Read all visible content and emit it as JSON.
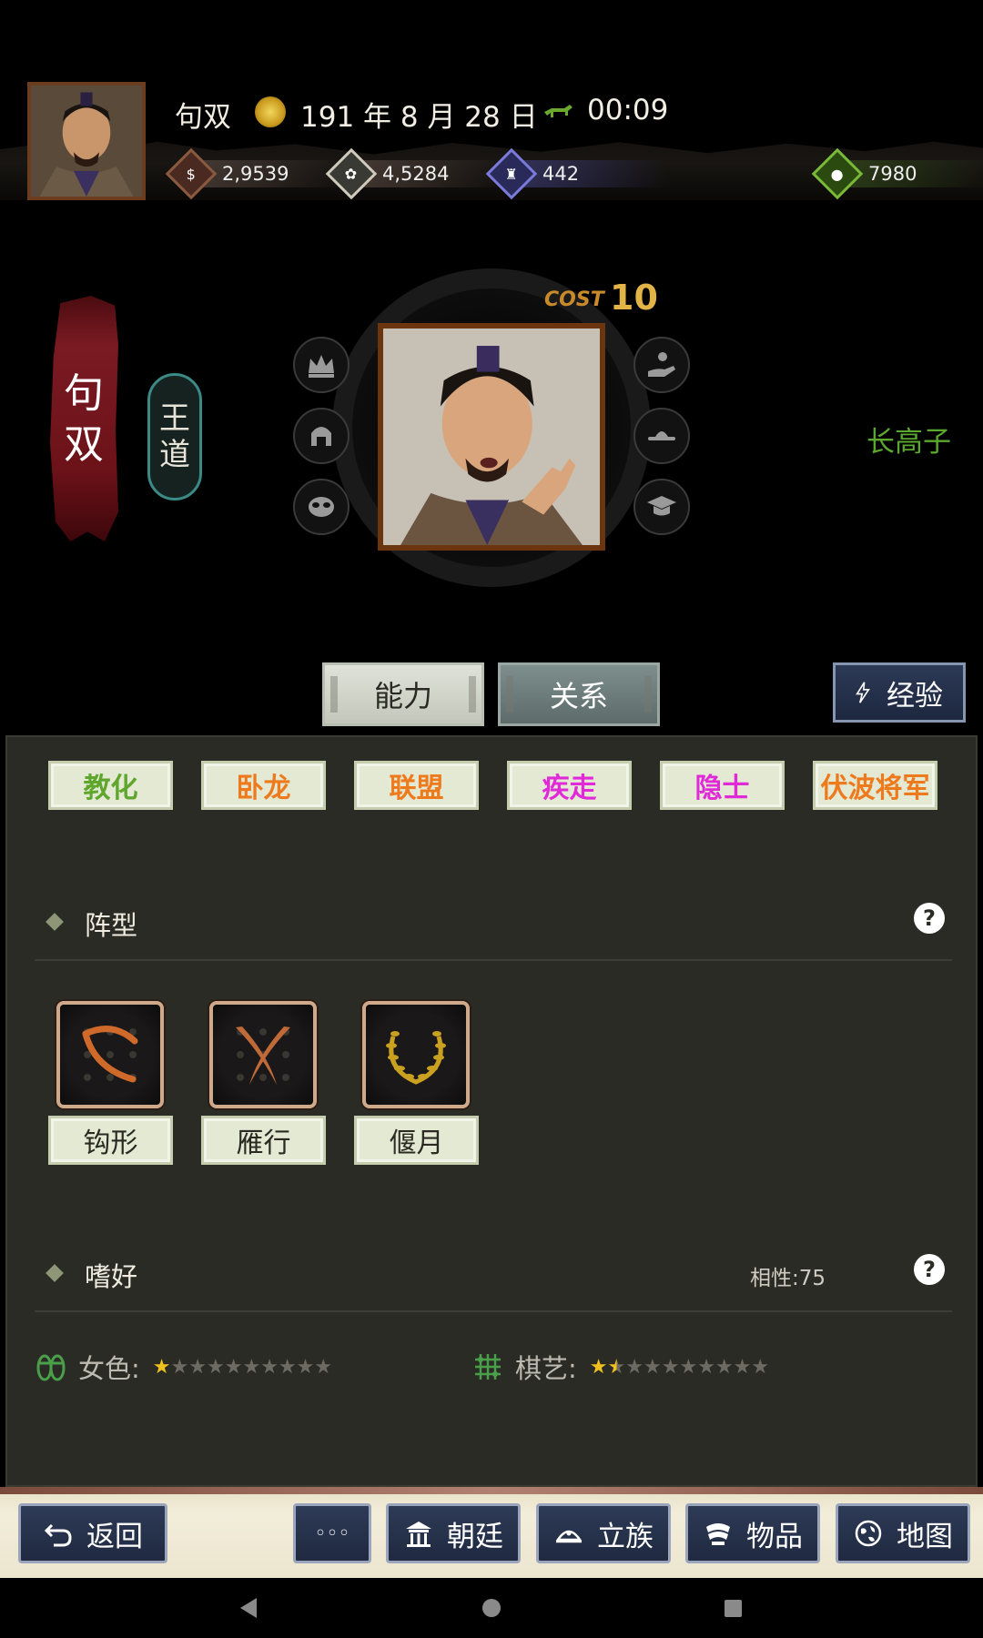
{
  "header": {
    "lord_name": "句双",
    "date": "191 年 8 月 28 日",
    "time": "00:09",
    "season_icon": "season-autumn-icon",
    "horse_icon": "horse-icon",
    "resources": {
      "gold": "2,9539",
      "grain": "4,5284",
      "troops": "442",
      "bag": "7980"
    }
  },
  "character": {
    "name": "句双",
    "ideology": "王道",
    "cost_label": "COST",
    "cost_value": "10",
    "nickname": "长高子",
    "status_icons": [
      "crown-icon",
      "helmet-icon",
      "mask-icon",
      "hand-icon",
      "hat-icon",
      "graduation-cap-icon"
    ]
  },
  "tabs": {
    "ability": "能力",
    "relations": "关系",
    "experience": "经验"
  },
  "traits": [
    {
      "label": "教化",
      "color": "#5fa62c"
    },
    {
      "label": "卧龙",
      "color": "#ee7a1e"
    },
    {
      "label": "联盟",
      "color": "#ee7a1e"
    },
    {
      "label": "疾走",
      "color": "#e02ad8"
    },
    {
      "label": "隐士",
      "color": "#e02ad8"
    },
    {
      "label": "伏波将军",
      "color": "#ee7a1e"
    }
  ],
  "formation": {
    "title": "阵型",
    "items": [
      {
        "label": "钩形",
        "icon": "hook-formation-icon"
      },
      {
        "label": "雁行",
        "icon": "geese-formation-icon"
      },
      {
        "label": "偃月",
        "icon": "crescent-formation-icon"
      }
    ]
  },
  "hobby": {
    "title": "嗜好",
    "affinity": "相性:75",
    "items": [
      {
        "label": "女色:",
        "icon": "sandals-icon",
        "stars": 1,
        "max": 10
      },
      {
        "label": "棋艺:",
        "icon": "go-board-icon",
        "stars": 1.5,
        "max": 10
      }
    ]
  },
  "bottom_nav": {
    "back": "返回",
    "more": "◦◦◦",
    "court": "朝廷",
    "clan": "立族",
    "items": "物品",
    "map": "地图"
  },
  "help_glyph": "?"
}
